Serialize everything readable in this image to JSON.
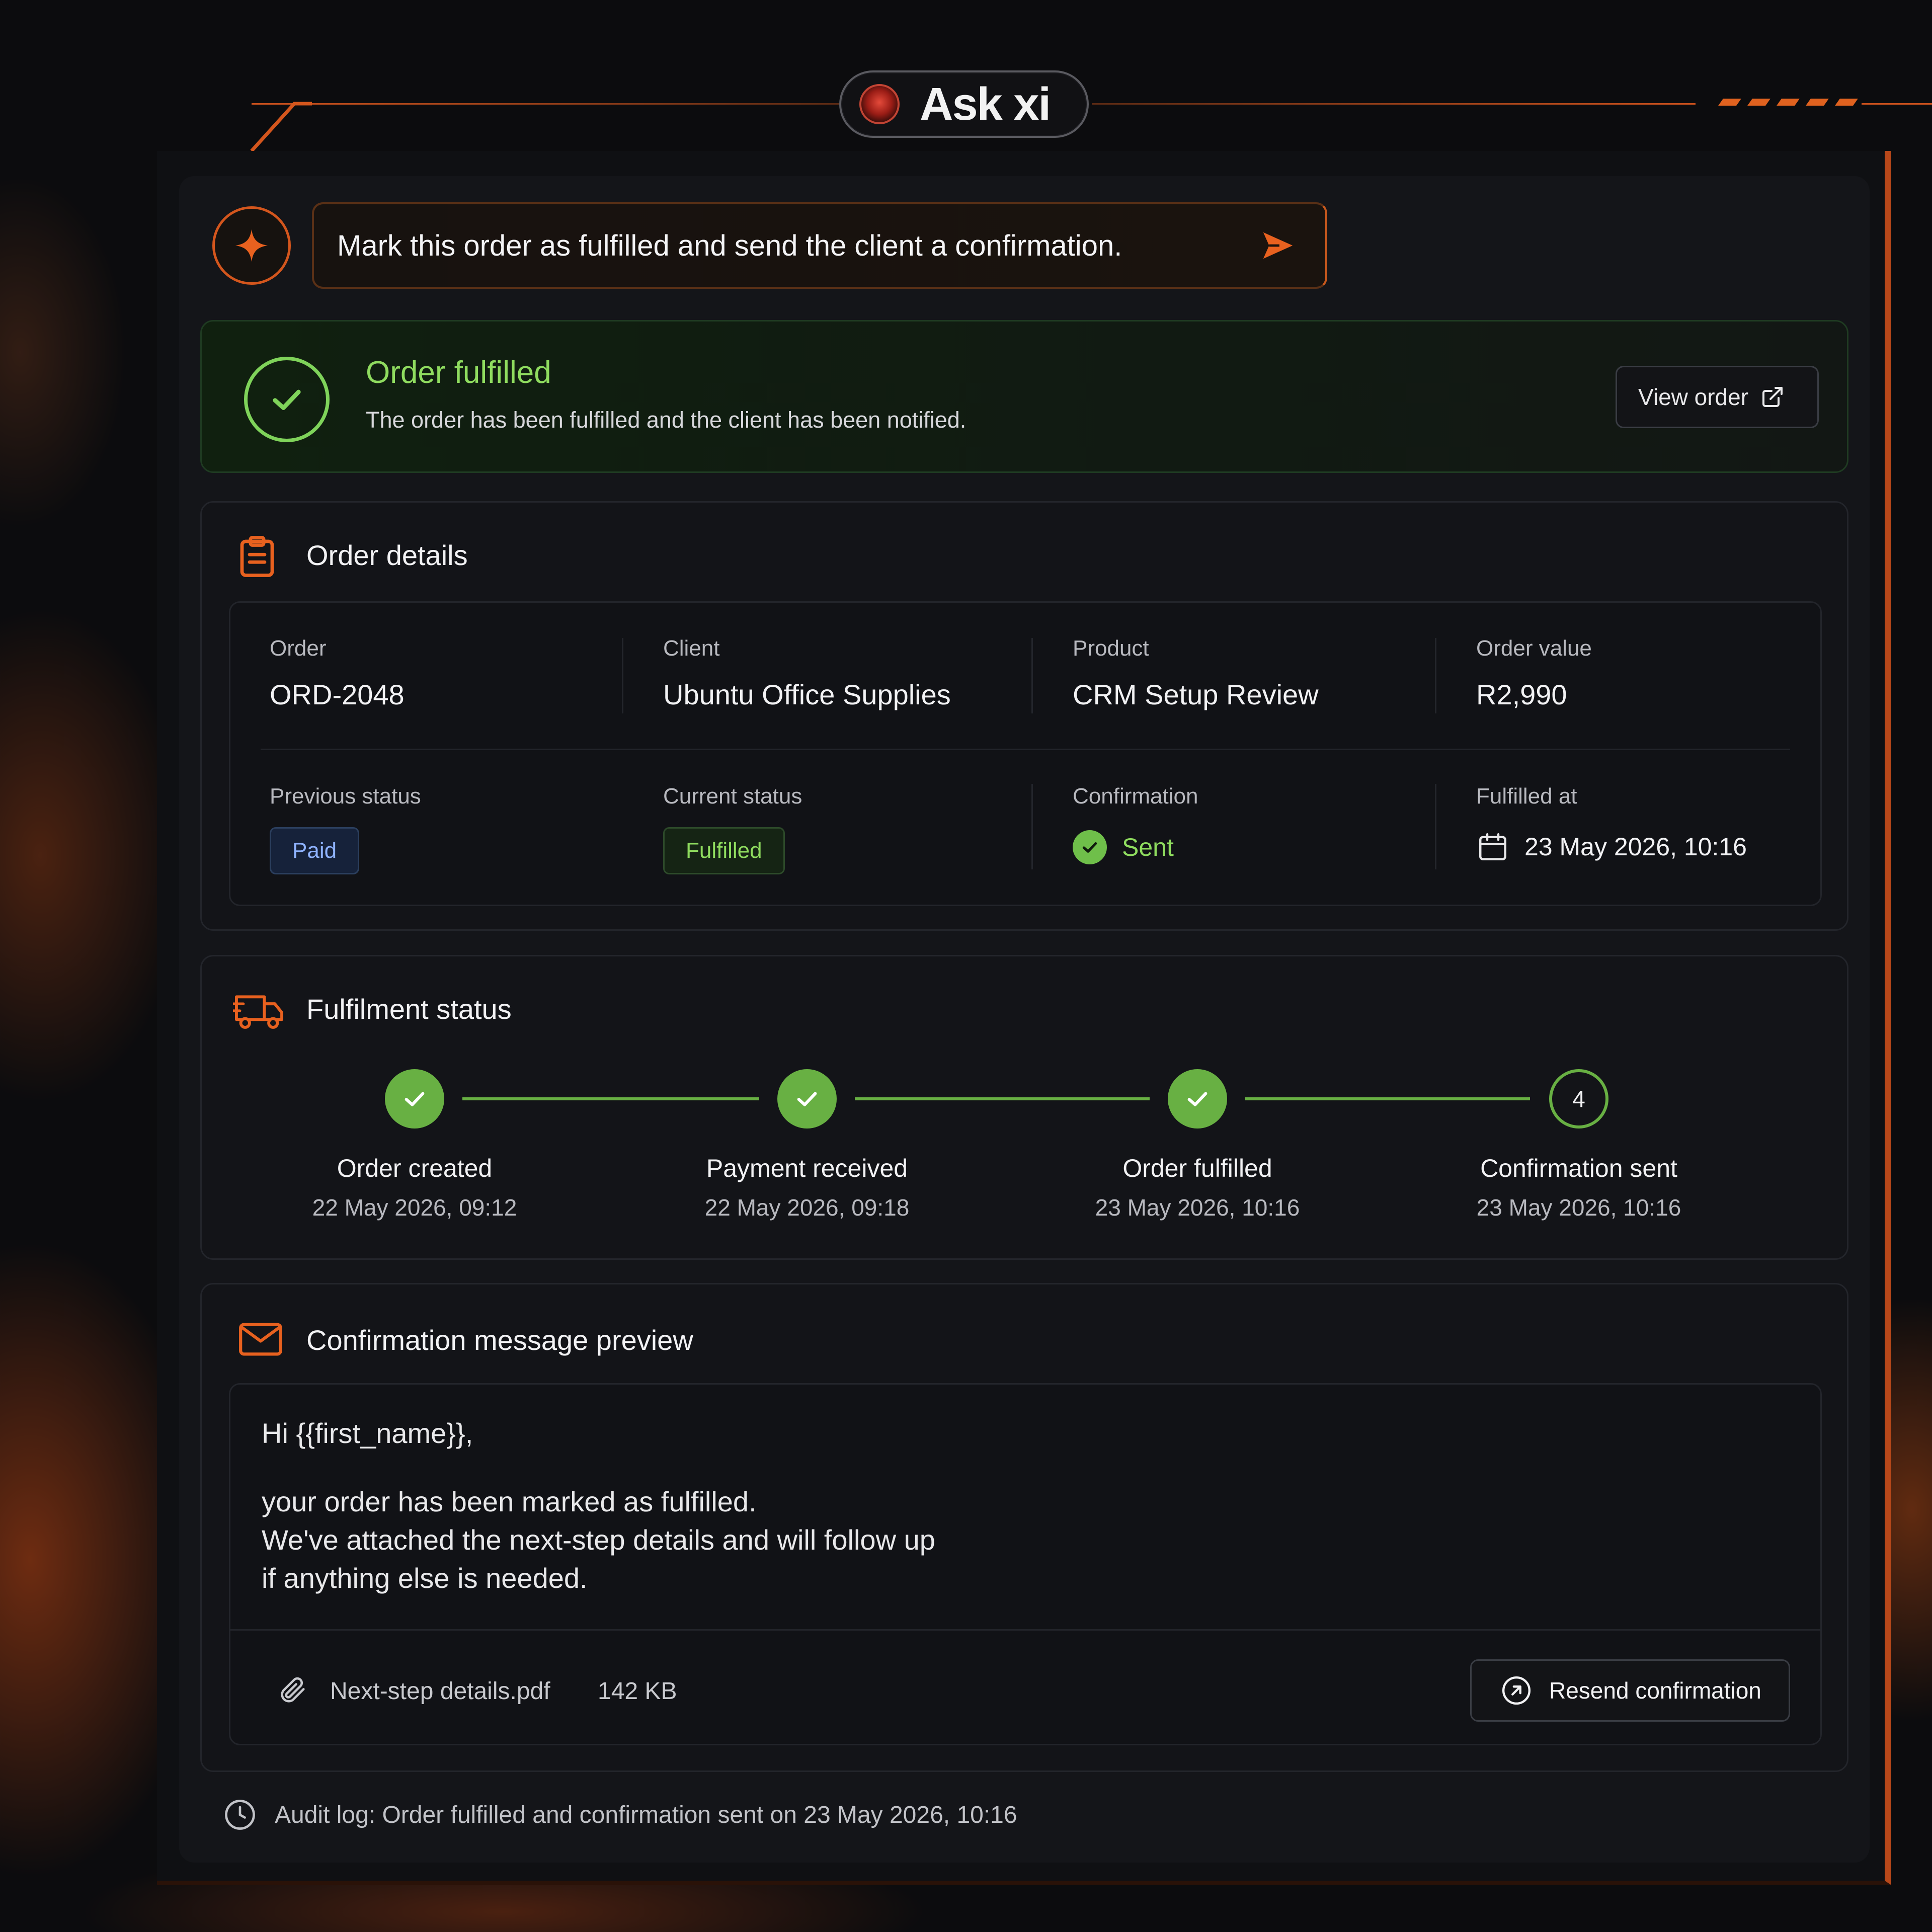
{
  "app": {
    "brand": "Ask xi"
  },
  "prompt": {
    "text": "Mark this order as fulfilled and send the client a confirmation.",
    "icon": "sparkle-icon",
    "send_icon": "send-icon"
  },
  "banner": {
    "title": "Order fulfilled",
    "subtitle": "The order has been fulfilled and the client has been notified.",
    "view_order_label": "View order"
  },
  "order_details": {
    "title": "Order details",
    "order_label": "Order",
    "order_value": "ORD-2048",
    "client_label": "Client",
    "client_value": "Ubuntu Office Supplies",
    "product_label": "Product",
    "product_value": "CRM Setup Review",
    "amount_label": "Order value",
    "amount_value": "R2,990",
    "prev_status_label": "Previous status",
    "prev_status_value": "Paid",
    "curr_status_label": "Current status",
    "curr_status_value": "Fulfilled",
    "confirmation_label": "Confirmation",
    "confirmation_value": "Sent",
    "fulfilled_at_label": "Fulfilled at",
    "fulfilled_at_value": "23 May 2026, 10:16"
  },
  "fulfilment": {
    "title": "Fulfilment status",
    "steps": [
      {
        "label": "Order created",
        "time": "22 May 2026, 09:12",
        "state": "done"
      },
      {
        "label": "Payment received",
        "time": "22 May 2026, 09:18",
        "state": "done"
      },
      {
        "label": "Order fulfilled",
        "time": "23 May 2026, 10:16",
        "state": "done"
      },
      {
        "label": "Confirmation sent",
        "time": "23 May 2026, 10:16",
        "state": "current",
        "number": "4"
      }
    ]
  },
  "preview": {
    "title": "Confirmation message preview",
    "greeting": "Hi {{first_name}},",
    "body_lines": [
      "your order has been marked as fulfilled.",
      "We've attached the next-step details and will follow up",
      "if anything else is needed."
    ],
    "attachment_name": "Next-step details.pdf",
    "attachment_size": "142 KB",
    "resend_label": "Resend confirmation"
  },
  "audit": {
    "text": "Audit log: Order fulfilled and confirmation sent on 23 May 2026, 10:16"
  },
  "colors": {
    "accent": "#d4561d",
    "success": "#8fdc5f",
    "success_fill": "#68b043",
    "info": "#8fb3ff"
  }
}
